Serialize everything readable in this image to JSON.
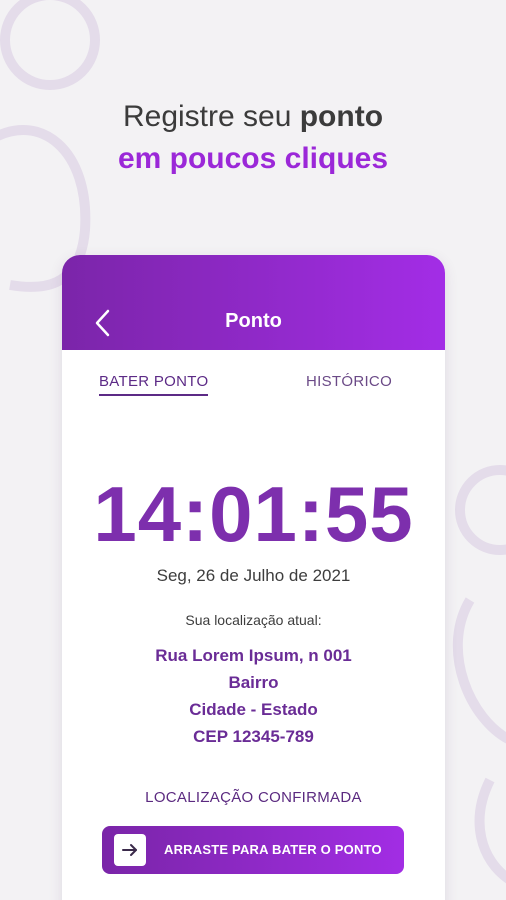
{
  "headline": {
    "line1_regular": "Registre seu",
    "line1_bold": "ponto",
    "line2": "em poucos cliques"
  },
  "header": {
    "title": "Ponto",
    "back_icon": "chevron-left-icon"
  },
  "tabs": [
    {
      "label": "BATER PONTO",
      "active": true
    },
    {
      "label": "HISTÓRICO",
      "active": false
    }
  ],
  "clock": {
    "time": "14:01:55"
  },
  "date": "Seg, 26 de Julho de 2021",
  "location": {
    "label": "Sua localização atual:",
    "street": "Rua Lorem Ipsum, n 001",
    "district": "Bairro",
    "city": "Cidade - Estado",
    "zip": "CEP 12345-789"
  },
  "status": "LOCALIZAÇÃO CONFIRMADA",
  "swipe": {
    "label": "ARRASTE PARA BATER O PONTO",
    "icon": "arrow-right-icon"
  },
  "colors": {
    "accent": "#9b28d8",
    "header_start": "#7b25a9",
    "header_end": "#a32de6",
    "clock": "#7d2fad",
    "background": "#f3f2f4"
  }
}
